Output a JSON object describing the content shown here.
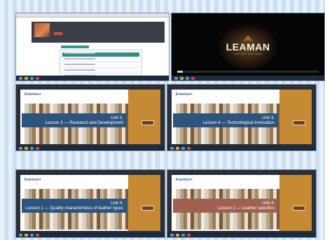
{
  "screens": {
    "s1": {
      "course_title": ""
    },
    "s2": {
      "logo_text": "LEAMAN",
      "logo_sub": "LEATHER MANAGER"
    },
    "slide1": {
      "brand": "Erasmus+",
      "unit": "Unit 3.",
      "lesson": "Lesson 3 — Research and Development"
    },
    "slide2": {
      "brand": "Erasmus+",
      "unit": "Unit 3.",
      "lesson": "Lesson 4 — Technological Innovation"
    },
    "slide3": {
      "brand": "Erasmus+",
      "unit": "Unit 4.",
      "lesson": "Lesson 1 — Quality characteristics of leather types"
    },
    "slide4": {
      "brand": "Erasmus+",
      "unit": "Unit 4.",
      "lesson": "Lesson 2 — Leather specifics"
    }
  },
  "colors": {
    "banner_blue": "#2c547f",
    "banner_brown": "#a06150",
    "panel_gold": "#c58a33",
    "lms_teal": "#2e8f86"
  }
}
